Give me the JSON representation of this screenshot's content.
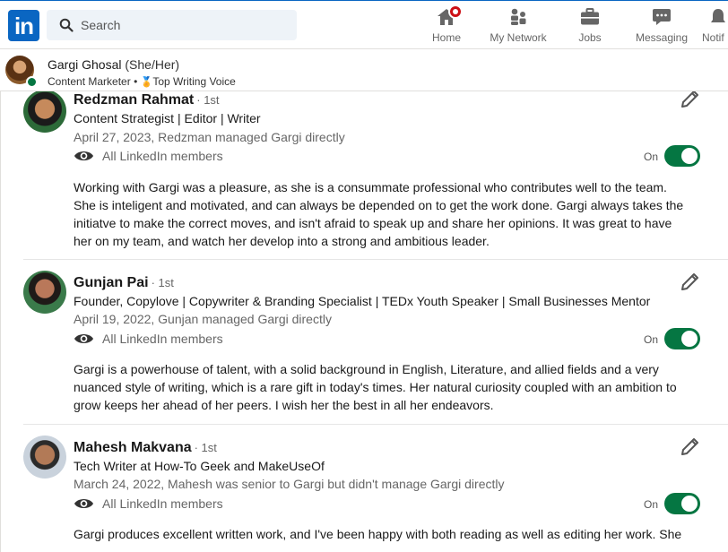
{
  "nav": {
    "logo_text": "in",
    "search_placeholder": "Search",
    "items": [
      {
        "label": "Home",
        "icon": "home-icon"
      },
      {
        "label": "My Network",
        "icon": "network-icon"
      },
      {
        "label": "Jobs",
        "icon": "briefcase-icon"
      },
      {
        "label": "Messaging",
        "icon": "chat-icon"
      },
      {
        "label": "Notif",
        "icon": "bell-icon"
      }
    ]
  },
  "profile": {
    "name": "Gargi Ghosal",
    "pronouns": "(She/Her)",
    "title": "Content Marketer",
    "separator": "•",
    "badge": "Top Writing Voice"
  },
  "recommendations": [
    {
      "name": "Redzman Rahmat",
      "degree": "· 1st",
      "headline": "Content Strategist | Editor | Writer",
      "date": "April 27, 2023, Redzman managed Gargi directly",
      "visibility": "All LinkedIn members",
      "toggle_label": "On",
      "toggle_on": true,
      "text": "Working with Gargi was a pleasure, as she is a consummate professional who contributes well to the team. She is inteligent and motivated, and can always be depended on to get the work done. Gargi always takes the initiatve to make the correct moves, and isn't afraid to speak up and share her opinions. It was great to have her on my team, and watch her develop into a strong and ambitious leader."
    },
    {
      "name": "Gunjan Pai",
      "degree": "· 1st",
      "headline": "Founder, Copylove | Copywriter & Branding Specialist | TEDx Youth Speaker | Small Businesses Mentor",
      "date": "April 19, 2022, Gunjan managed Gargi directly",
      "visibility": "All LinkedIn members",
      "toggle_label": "On",
      "toggle_on": true,
      "text": "Gargi is a powerhouse of talent, with a solid background in English, Literature, and allied fields and a very nuanced style of writing, which is a rare gift in today's times. Her natural curiosity coupled with an ambition to grow keeps her ahead of her peers. I wish her the best in all her endeavors."
    },
    {
      "name": "Mahesh Makvana",
      "degree": "· 1st",
      "headline": "Tech Writer at How-To Geek and MakeUseOf",
      "date": "March 24, 2022, Mahesh was senior to Gargi but didn't manage Gargi directly",
      "visibility": "All LinkedIn members",
      "toggle_label": "On",
      "toggle_on": true,
      "text": "Gargi produces excellent written work, and I've been happy with both reading as well as editing her work. She"
    }
  ],
  "colors": {
    "brand": "#0a66c2",
    "toggle_on": "#057642",
    "notification": "#cc1016"
  }
}
